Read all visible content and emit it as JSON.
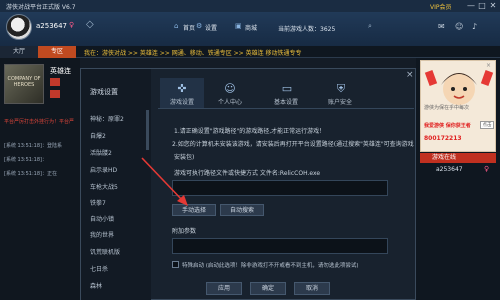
{
  "app": {
    "title": "游侠对战平台正式版 V6.7",
    "vip_label": "VIP会员"
  },
  "window_controls": [
    "—",
    "□",
    "✕"
  ],
  "user": {
    "name": "a253647",
    "gender_icon": "♀"
  },
  "nav": [
    {
      "label": "首页",
      "icon": "home-icon"
    },
    {
      "label": "设置",
      "icon": "gear-icon"
    },
    {
      "label": "商城",
      "icon": "shop-icon"
    }
  ],
  "online_count": "当前游戏人数：3625",
  "tabs": {
    "lobby": "大厅",
    "zone": "专区"
  },
  "breadcrumb": "我在：游侠对战 >> 英雄连 >> 网通、移动、铁通专区 >> 英雄连 移动铁通专专",
  "game": {
    "name": "英雄连",
    "cover_label": "COMPANY OF HEROES"
  },
  "notice": "平台严厉打击外挂行为！平台严",
  "system_log": [
    "[系统 13:51:18]：登陆系",
    "[系统 13:51:18]：",
    "[系统 13:51:18]：正在"
  ],
  "ad": {
    "text": "游侠为保在乎中每次",
    "headline": "我爱游侠 保你获王者",
    "button": "点击",
    "hotline": "800172213",
    "close": "×"
  },
  "online_panel": {
    "title": "游戏在线",
    "user": "a253647",
    "gender_icon": "♀"
  },
  "dialog": {
    "title": "游戏设置",
    "close": "×",
    "games": [
      "神秘：原罪2",
      "自爆2",
      "活骷髅2",
      "启示录HD",
      "车枪大战5",
      "铁拳7",
      "自动小镇",
      "我的世界",
      "饥荒联机版",
      "七日杀",
      "森林"
    ],
    "tabs": [
      {
        "label": "游戏设置",
        "icon": "gamepad-icon"
      },
      {
        "label": "个人中心",
        "icon": "user-icon"
      },
      {
        "label": "基本设置",
        "icon": "monitor-icon"
      },
      {
        "label": "账户安全",
        "icon": "shield-icon"
      }
    ],
    "hints": [
      "1.请正确设置\"游戏路径\"的游戏路径,才能正常运行游戏！",
      "2.如您的计算机未安装该游戏，请安装后再打开平台设置路径(通过搜索\"英雄连\"可查询游戏",
      "安装包)"
    ],
    "path_label": "游戏可执行路径文件或快捷方式 文件名:RelicCOH.exe",
    "path_value": "",
    "manual_btn": "手动选择",
    "auto_btn": "自动搜索",
    "params_label": "附加参数",
    "params_value": "",
    "special_label": "特殊启动 (启动此选项！除非游戏打不开或看不到主机，请勿选此项尝试)",
    "actions": [
      "应用",
      "确定",
      "取消"
    ]
  },
  "colors": {
    "accent": "#c04a20",
    "arrow": "#e53935",
    "notice": "#e0463a"
  }
}
